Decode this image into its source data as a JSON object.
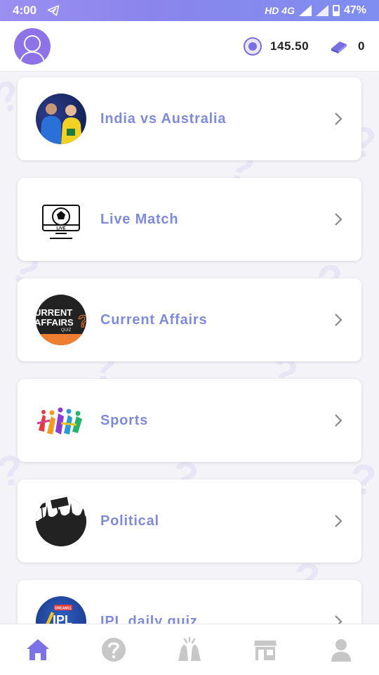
{
  "status_bar": {
    "time": "4:00",
    "network": "HD 4G",
    "battery": "47%"
  },
  "header": {
    "coins": "145.50",
    "gems": "0"
  },
  "categories": [
    {
      "title": "India vs Australia",
      "icon": "cricket-players-thumb"
    },
    {
      "title": "Live Match",
      "icon": "live-football-tv-thumb",
      "thumb_text": "LIVE"
    },
    {
      "title": "Current Affairs",
      "icon": "current-affairs-thumb",
      "thumb_text_1": "URRENT",
      "thumb_text_2": "AFFAIRS",
      "thumb_text_3": "QUIZ"
    },
    {
      "title": "Sports",
      "icon": "sports-silhouettes-thumb"
    },
    {
      "title": "Political",
      "icon": "political-crowd-thumb"
    },
    {
      "title": "IPL daily quiz",
      "icon": "ipl-logo-thumb",
      "thumb_text_1": "DREAM11",
      "thumb_text_2": "IPL"
    }
  ],
  "nav": [
    {
      "name": "home",
      "active": true
    },
    {
      "name": "help"
    },
    {
      "name": "celebrate"
    },
    {
      "name": "store"
    },
    {
      "name": "profile"
    }
  ],
  "colors": {
    "accent": "#7e8bdc",
    "status_gradient_start": "#9b8ff0",
    "status_gradient_end": "#7f8ef0",
    "nav_active": "#7c74e6",
    "nav_inactive": "#c7c7c7"
  }
}
